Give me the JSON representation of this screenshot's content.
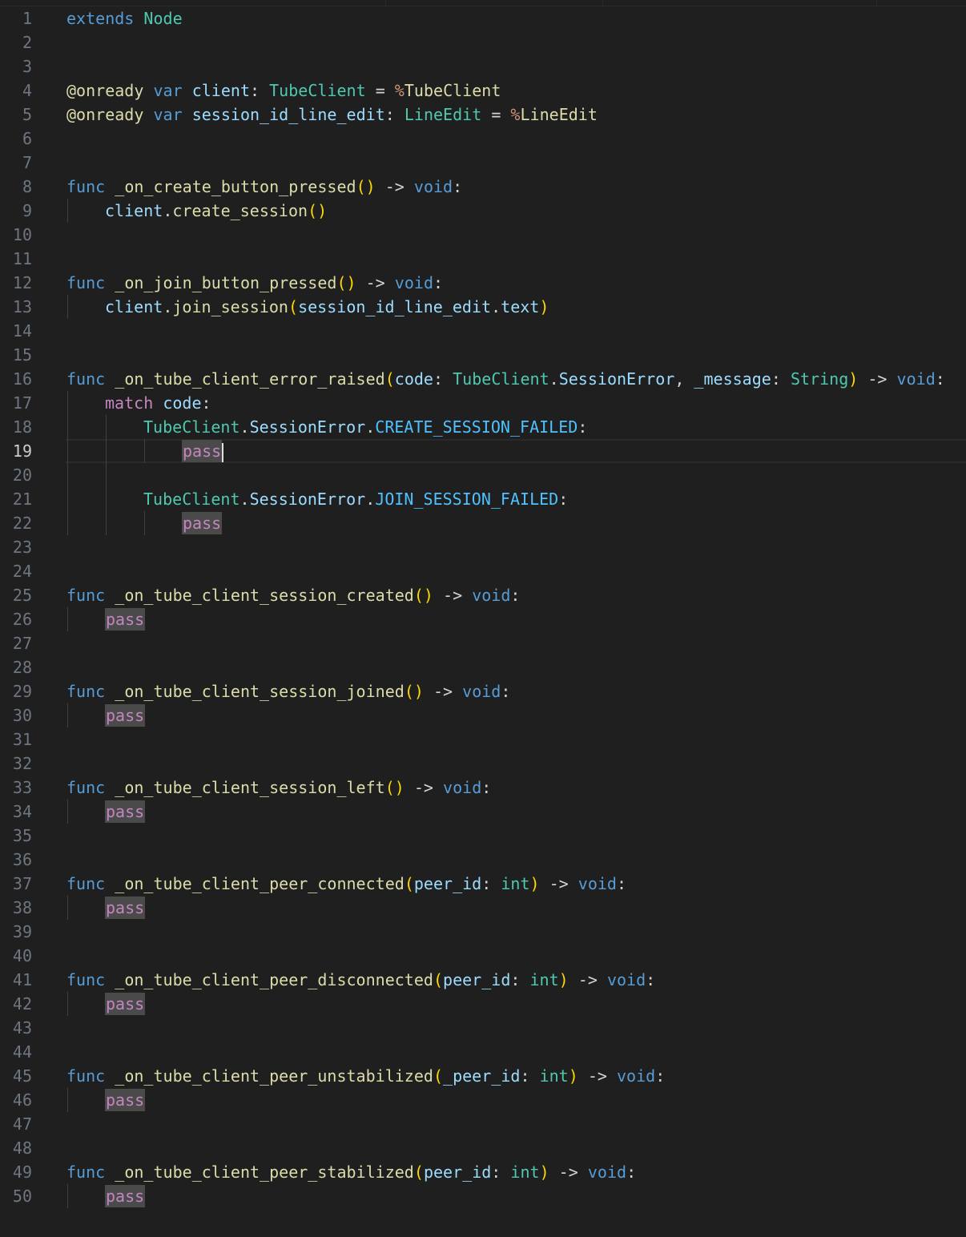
{
  "editor": {
    "current_line": 19,
    "colors": {
      "background": "#1f1f1f",
      "keyword": "#569cd6",
      "control": "#c586c0",
      "type": "#4ec9b0",
      "function": "#dcdcaa",
      "variable": "#9cdcfe",
      "constant": "#4fc1ff",
      "bracket": "#ffd700"
    },
    "lines": [
      {
        "n": "1",
        "indent": 0,
        "tokens": [
          {
            "t": "extends",
            "c": "kw"
          },
          {
            "t": " ",
            "c": "p"
          },
          {
            "t": "Node",
            "c": "type"
          }
        ]
      },
      {
        "n": "2",
        "indent": 0,
        "tokens": []
      },
      {
        "n": "3",
        "indent": 0,
        "tokens": []
      },
      {
        "n": "4",
        "indent": 0,
        "tokens": [
          {
            "t": "@onready",
            "c": "anno"
          },
          {
            "t": " ",
            "c": "p"
          },
          {
            "t": "var",
            "c": "kw"
          },
          {
            "t": " ",
            "c": "p"
          },
          {
            "t": "client",
            "c": "var"
          },
          {
            "t": ": ",
            "c": "p"
          },
          {
            "t": "TubeClient",
            "c": "type"
          },
          {
            "t": " = ",
            "c": "op"
          },
          {
            "t": "%",
            "c": "pct"
          },
          {
            "t": "TubeClient",
            "c": "fn"
          }
        ]
      },
      {
        "n": "5",
        "indent": 0,
        "tokens": [
          {
            "t": "@onready",
            "c": "anno"
          },
          {
            "t": " ",
            "c": "p"
          },
          {
            "t": "var",
            "c": "kw"
          },
          {
            "t": " ",
            "c": "p"
          },
          {
            "t": "session_id_line_edit",
            "c": "var"
          },
          {
            "t": ": ",
            "c": "p"
          },
          {
            "t": "LineEdit",
            "c": "type"
          },
          {
            "t": " = ",
            "c": "op"
          },
          {
            "t": "%",
            "c": "pct"
          },
          {
            "t": "LineEdit",
            "c": "fn"
          }
        ]
      },
      {
        "n": "6",
        "indent": 0,
        "tokens": []
      },
      {
        "n": "7",
        "indent": 0,
        "tokens": []
      },
      {
        "n": "8",
        "indent": 0,
        "tokens": [
          {
            "t": "func",
            "c": "kw"
          },
          {
            "t": " ",
            "c": "p"
          },
          {
            "t": "_on_create_button_pressed",
            "c": "fn"
          },
          {
            "t": "()",
            "c": "paren"
          },
          {
            "t": " -> ",
            "c": "op"
          },
          {
            "t": "void",
            "c": "kw"
          },
          {
            "t": ":",
            "c": "p"
          }
        ]
      },
      {
        "n": "9",
        "indent": 1,
        "tokens": [
          {
            "t": "client",
            "c": "var"
          },
          {
            "t": ".",
            "c": "p"
          },
          {
            "t": "create_session",
            "c": "fn"
          },
          {
            "t": "()",
            "c": "paren"
          }
        ]
      },
      {
        "n": "10",
        "indent": 0,
        "tokens": []
      },
      {
        "n": "11",
        "indent": 0,
        "tokens": []
      },
      {
        "n": "12",
        "indent": 0,
        "tokens": [
          {
            "t": "func",
            "c": "kw"
          },
          {
            "t": " ",
            "c": "p"
          },
          {
            "t": "_on_join_button_pressed",
            "c": "fn"
          },
          {
            "t": "()",
            "c": "paren"
          },
          {
            "t": " -> ",
            "c": "op"
          },
          {
            "t": "void",
            "c": "kw"
          },
          {
            "t": ":",
            "c": "p"
          }
        ]
      },
      {
        "n": "13",
        "indent": 1,
        "tokens": [
          {
            "t": "client",
            "c": "var"
          },
          {
            "t": ".",
            "c": "p"
          },
          {
            "t": "join_session",
            "c": "fn"
          },
          {
            "t": "(",
            "c": "paren"
          },
          {
            "t": "session_id_line_edit",
            "c": "var"
          },
          {
            "t": ".",
            "c": "p"
          },
          {
            "t": "text",
            "c": "var"
          },
          {
            "t": ")",
            "c": "paren"
          }
        ]
      },
      {
        "n": "14",
        "indent": 0,
        "tokens": []
      },
      {
        "n": "15",
        "indent": 0,
        "tokens": []
      },
      {
        "n": "16",
        "indent": 0,
        "tokens": [
          {
            "t": "func",
            "c": "kw"
          },
          {
            "t": " ",
            "c": "p"
          },
          {
            "t": "_on_tube_client_error_raised",
            "c": "fn"
          },
          {
            "t": "(",
            "c": "paren"
          },
          {
            "t": "code",
            "c": "var"
          },
          {
            "t": ": ",
            "c": "p"
          },
          {
            "t": "TubeClient",
            "c": "type"
          },
          {
            "t": ".",
            "c": "p"
          },
          {
            "t": "SessionError",
            "c": "var"
          },
          {
            "t": ", ",
            "c": "p"
          },
          {
            "t": "_message",
            "c": "var"
          },
          {
            "t": ": ",
            "c": "p"
          },
          {
            "t": "String",
            "c": "type"
          },
          {
            "t": ")",
            "c": "paren"
          },
          {
            "t": " -> ",
            "c": "op"
          },
          {
            "t": "void",
            "c": "kw"
          },
          {
            "t": ":",
            "c": "p"
          }
        ]
      },
      {
        "n": "17",
        "indent": 1,
        "tokens": [
          {
            "t": "match",
            "c": "ctrl"
          },
          {
            "t": " ",
            "c": "p"
          },
          {
            "t": "code",
            "c": "var"
          },
          {
            "t": ":",
            "c": "p"
          }
        ]
      },
      {
        "n": "18",
        "indent": 2,
        "tokens": [
          {
            "t": "TubeClient",
            "c": "type"
          },
          {
            "t": ".",
            "c": "p"
          },
          {
            "t": "SessionError",
            "c": "var"
          },
          {
            "t": ".",
            "c": "p"
          },
          {
            "t": "CREATE_SESSION_FAILED",
            "c": "const"
          },
          {
            "t": ":",
            "c": "p"
          }
        ]
      },
      {
        "n": "19",
        "indent": 3,
        "cursor": true,
        "tokens": [
          {
            "t": "pass",
            "c": "pass"
          }
        ]
      },
      {
        "n": "20",
        "indent": 0,
        "guides": 2,
        "tokens": []
      },
      {
        "n": "21",
        "indent": 2,
        "tokens": [
          {
            "t": "TubeClient",
            "c": "type"
          },
          {
            "t": ".",
            "c": "p"
          },
          {
            "t": "SessionError",
            "c": "var"
          },
          {
            "t": ".",
            "c": "p"
          },
          {
            "t": "JOIN_SESSION_FAILED",
            "c": "const"
          },
          {
            "t": ":",
            "c": "p"
          }
        ]
      },
      {
        "n": "22",
        "indent": 3,
        "tokens": [
          {
            "t": "pass",
            "c": "pass"
          }
        ]
      },
      {
        "n": "23",
        "indent": 0,
        "tokens": []
      },
      {
        "n": "24",
        "indent": 0,
        "tokens": []
      },
      {
        "n": "25",
        "indent": 0,
        "tokens": [
          {
            "t": "func",
            "c": "kw"
          },
          {
            "t": " ",
            "c": "p"
          },
          {
            "t": "_on_tube_client_session_created",
            "c": "fn"
          },
          {
            "t": "()",
            "c": "paren"
          },
          {
            "t": " -> ",
            "c": "op"
          },
          {
            "t": "void",
            "c": "kw"
          },
          {
            "t": ":",
            "c": "p"
          }
        ]
      },
      {
        "n": "26",
        "indent": 1,
        "tokens": [
          {
            "t": "pass",
            "c": "pass"
          }
        ]
      },
      {
        "n": "27",
        "indent": 0,
        "tokens": []
      },
      {
        "n": "28",
        "indent": 0,
        "tokens": []
      },
      {
        "n": "29",
        "indent": 0,
        "tokens": [
          {
            "t": "func",
            "c": "kw"
          },
          {
            "t": " ",
            "c": "p"
          },
          {
            "t": "_on_tube_client_session_joined",
            "c": "fn"
          },
          {
            "t": "()",
            "c": "paren"
          },
          {
            "t": " -> ",
            "c": "op"
          },
          {
            "t": "void",
            "c": "kw"
          },
          {
            "t": ":",
            "c": "p"
          }
        ]
      },
      {
        "n": "30",
        "indent": 1,
        "tokens": [
          {
            "t": "pass",
            "c": "pass"
          }
        ]
      },
      {
        "n": "31",
        "indent": 0,
        "tokens": []
      },
      {
        "n": "32",
        "indent": 0,
        "tokens": []
      },
      {
        "n": "33",
        "indent": 0,
        "tokens": [
          {
            "t": "func",
            "c": "kw"
          },
          {
            "t": " ",
            "c": "p"
          },
          {
            "t": "_on_tube_client_session_left",
            "c": "fn"
          },
          {
            "t": "()",
            "c": "paren"
          },
          {
            "t": " -> ",
            "c": "op"
          },
          {
            "t": "void",
            "c": "kw"
          },
          {
            "t": ":",
            "c": "p"
          }
        ]
      },
      {
        "n": "34",
        "indent": 1,
        "tokens": [
          {
            "t": "pass",
            "c": "pass"
          }
        ]
      },
      {
        "n": "35",
        "indent": 0,
        "tokens": []
      },
      {
        "n": "36",
        "indent": 0,
        "tokens": []
      },
      {
        "n": "37",
        "indent": 0,
        "tokens": [
          {
            "t": "func",
            "c": "kw"
          },
          {
            "t": " ",
            "c": "p"
          },
          {
            "t": "_on_tube_client_peer_connected",
            "c": "fn"
          },
          {
            "t": "(",
            "c": "paren"
          },
          {
            "t": "peer_id",
            "c": "var"
          },
          {
            "t": ": ",
            "c": "p"
          },
          {
            "t": "int",
            "c": "type"
          },
          {
            "t": ")",
            "c": "paren"
          },
          {
            "t": " -> ",
            "c": "op"
          },
          {
            "t": "void",
            "c": "kw"
          },
          {
            "t": ":",
            "c": "p"
          }
        ]
      },
      {
        "n": "38",
        "indent": 1,
        "tokens": [
          {
            "t": "pass",
            "c": "pass"
          }
        ]
      },
      {
        "n": "39",
        "indent": 0,
        "tokens": []
      },
      {
        "n": "40",
        "indent": 0,
        "tokens": []
      },
      {
        "n": "41",
        "indent": 0,
        "tokens": [
          {
            "t": "func",
            "c": "kw"
          },
          {
            "t": " ",
            "c": "p"
          },
          {
            "t": "_on_tube_client_peer_disconnected",
            "c": "fn"
          },
          {
            "t": "(",
            "c": "paren"
          },
          {
            "t": "peer_id",
            "c": "var"
          },
          {
            "t": ": ",
            "c": "p"
          },
          {
            "t": "int",
            "c": "type"
          },
          {
            "t": ")",
            "c": "paren"
          },
          {
            "t": " -> ",
            "c": "op"
          },
          {
            "t": "void",
            "c": "kw"
          },
          {
            "t": ":",
            "c": "p"
          }
        ]
      },
      {
        "n": "42",
        "indent": 1,
        "tokens": [
          {
            "t": "pass",
            "c": "pass"
          }
        ]
      },
      {
        "n": "43",
        "indent": 0,
        "tokens": []
      },
      {
        "n": "44",
        "indent": 0,
        "tokens": []
      },
      {
        "n": "45",
        "indent": 0,
        "tokens": [
          {
            "t": "func",
            "c": "kw"
          },
          {
            "t": " ",
            "c": "p"
          },
          {
            "t": "_on_tube_client_peer_unstabilized",
            "c": "fn"
          },
          {
            "t": "(",
            "c": "paren"
          },
          {
            "t": "_peer_id",
            "c": "var"
          },
          {
            "t": ": ",
            "c": "p"
          },
          {
            "t": "int",
            "c": "type"
          },
          {
            "t": ")",
            "c": "paren"
          },
          {
            "t": " -> ",
            "c": "op"
          },
          {
            "t": "void",
            "c": "kw"
          },
          {
            "t": ":",
            "c": "p"
          }
        ]
      },
      {
        "n": "46",
        "indent": 1,
        "tokens": [
          {
            "t": "pass",
            "c": "pass"
          }
        ]
      },
      {
        "n": "47",
        "indent": 0,
        "tokens": []
      },
      {
        "n": "48",
        "indent": 0,
        "tokens": []
      },
      {
        "n": "49",
        "indent": 0,
        "tokens": [
          {
            "t": "func",
            "c": "kw"
          },
          {
            "t": " ",
            "c": "p"
          },
          {
            "t": "_on_tube_client_peer_stabilized",
            "c": "fn"
          },
          {
            "t": "(",
            "c": "paren"
          },
          {
            "t": "peer_id",
            "c": "var"
          },
          {
            "t": ": ",
            "c": "p"
          },
          {
            "t": "int",
            "c": "type"
          },
          {
            "t": ")",
            "c": "paren"
          },
          {
            "t": " -> ",
            "c": "op"
          },
          {
            "t": "void",
            "c": "kw"
          },
          {
            "t": ":",
            "c": "p"
          }
        ]
      },
      {
        "n": "50",
        "indent": 1,
        "tokens": [
          {
            "t": "pass",
            "c": "pass"
          }
        ]
      }
    ]
  }
}
